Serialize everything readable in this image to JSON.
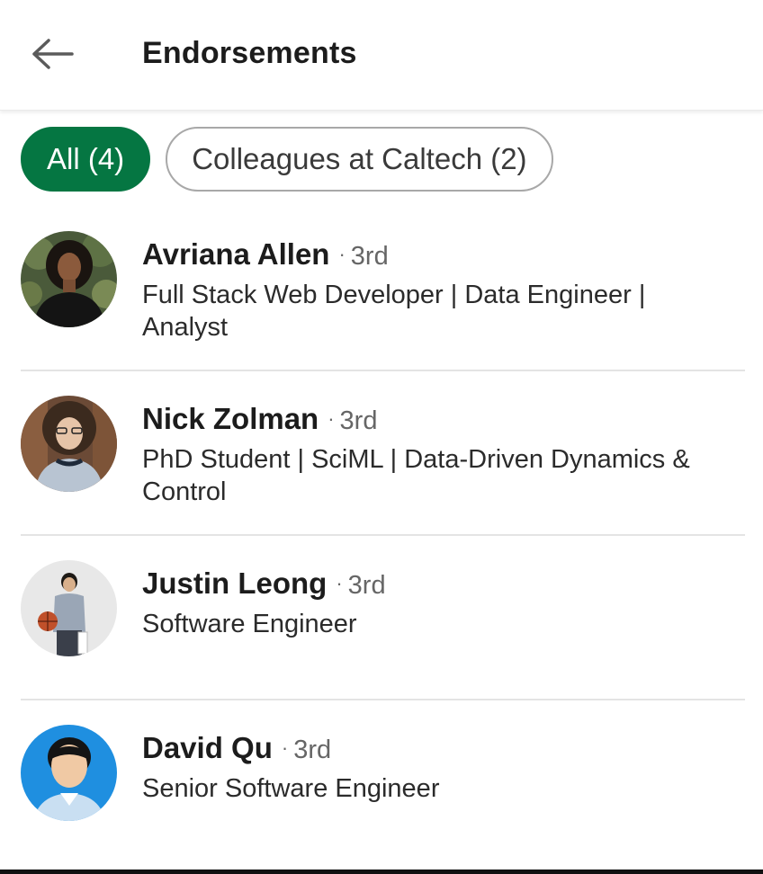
{
  "header": {
    "title": "Endorsements",
    "back_icon": "arrow-left-icon"
  },
  "filters": [
    {
      "label": "All (4)",
      "active": true
    },
    {
      "label": "Colleagues at Caltech (2)",
      "active": false
    }
  ],
  "colors": {
    "accent": "#057642",
    "chip_border": "#a8a8a8",
    "divider": "#e4e4e4",
    "degree_text": "#666666"
  },
  "endorsers": [
    {
      "name": "Avriana Allen",
      "degree": "3rd",
      "headline": "Full Stack Web Developer | Data Engineer | Analyst"
    },
    {
      "name": "Nick Zolman",
      "degree": "3rd",
      "headline": "PhD Student | SciML | Data-Driven Dynamics & Control"
    },
    {
      "name": "Justin Leong",
      "degree": "3rd",
      "headline": "Software Engineer"
    },
    {
      "name": "David Qu",
      "degree": "3rd",
      "headline": "Senior Software Engineer"
    }
  ]
}
